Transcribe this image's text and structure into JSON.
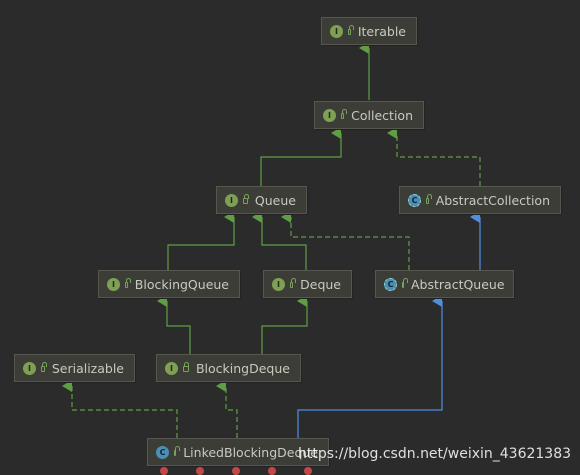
{
  "colors": {
    "background": "#2b2b2b",
    "interface_extends_arrow": "#5f9e45",
    "implements_dashed": "#5f9e45",
    "class_extends_arrow": "#4e8fe0"
  },
  "nodes": {
    "iterable": {
      "label": "Iterable",
      "kind": "interface",
      "badge": "I"
    },
    "collection": {
      "label": "Collection",
      "kind": "interface",
      "badge": "I"
    },
    "queue": {
      "label": "Queue",
      "kind": "interface",
      "badge": "I"
    },
    "abstract_collection": {
      "label": "AbstractCollection",
      "kind": "abstract-class",
      "badge": "C"
    },
    "blocking_queue": {
      "label": "BlockingQueue",
      "kind": "interface",
      "badge": "I"
    },
    "deque": {
      "label": "Deque",
      "kind": "interface",
      "badge": "I"
    },
    "abstract_queue": {
      "label": "AbstractQueue",
      "kind": "abstract-class",
      "badge": "C"
    },
    "serializable": {
      "label": "Serializable",
      "kind": "interface",
      "badge": "I"
    },
    "blocking_deque": {
      "label": "BlockingDeque",
      "kind": "interface",
      "badge": "I"
    },
    "linked_blocking_deque": {
      "label": "LinkedBlockingDeque",
      "kind": "class",
      "badge": "C"
    }
  },
  "edges": [
    {
      "from": "collection",
      "to": "iterable",
      "style": "solid",
      "type": "extends"
    },
    {
      "from": "queue",
      "to": "collection",
      "style": "solid",
      "type": "extends"
    },
    {
      "from": "abstract_collection",
      "to": "collection",
      "style": "dashed",
      "type": "implements"
    },
    {
      "from": "blocking_queue",
      "to": "queue",
      "style": "solid",
      "type": "extends"
    },
    {
      "from": "deque",
      "to": "queue",
      "style": "solid",
      "type": "extends"
    },
    {
      "from": "abstract_queue",
      "to": "queue",
      "style": "dashed",
      "type": "implements"
    },
    {
      "from": "abstract_queue",
      "to": "abstract_collection",
      "style": "solid-blue",
      "type": "extends"
    },
    {
      "from": "blocking_deque",
      "to": "blocking_queue",
      "style": "solid",
      "type": "extends"
    },
    {
      "from": "blocking_deque",
      "to": "deque",
      "style": "solid",
      "type": "extends"
    },
    {
      "from": "linked_blocking_deque",
      "to": "serializable",
      "style": "dashed",
      "type": "implements"
    },
    {
      "from": "linked_blocking_deque",
      "to": "blocking_deque",
      "style": "dashed",
      "type": "implements"
    },
    {
      "from": "linked_blocking_deque",
      "to": "abstract_queue",
      "style": "solid-blue",
      "type": "extends"
    }
  ],
  "watermark": "https://blog.csdn.net/weixin_43621383"
}
